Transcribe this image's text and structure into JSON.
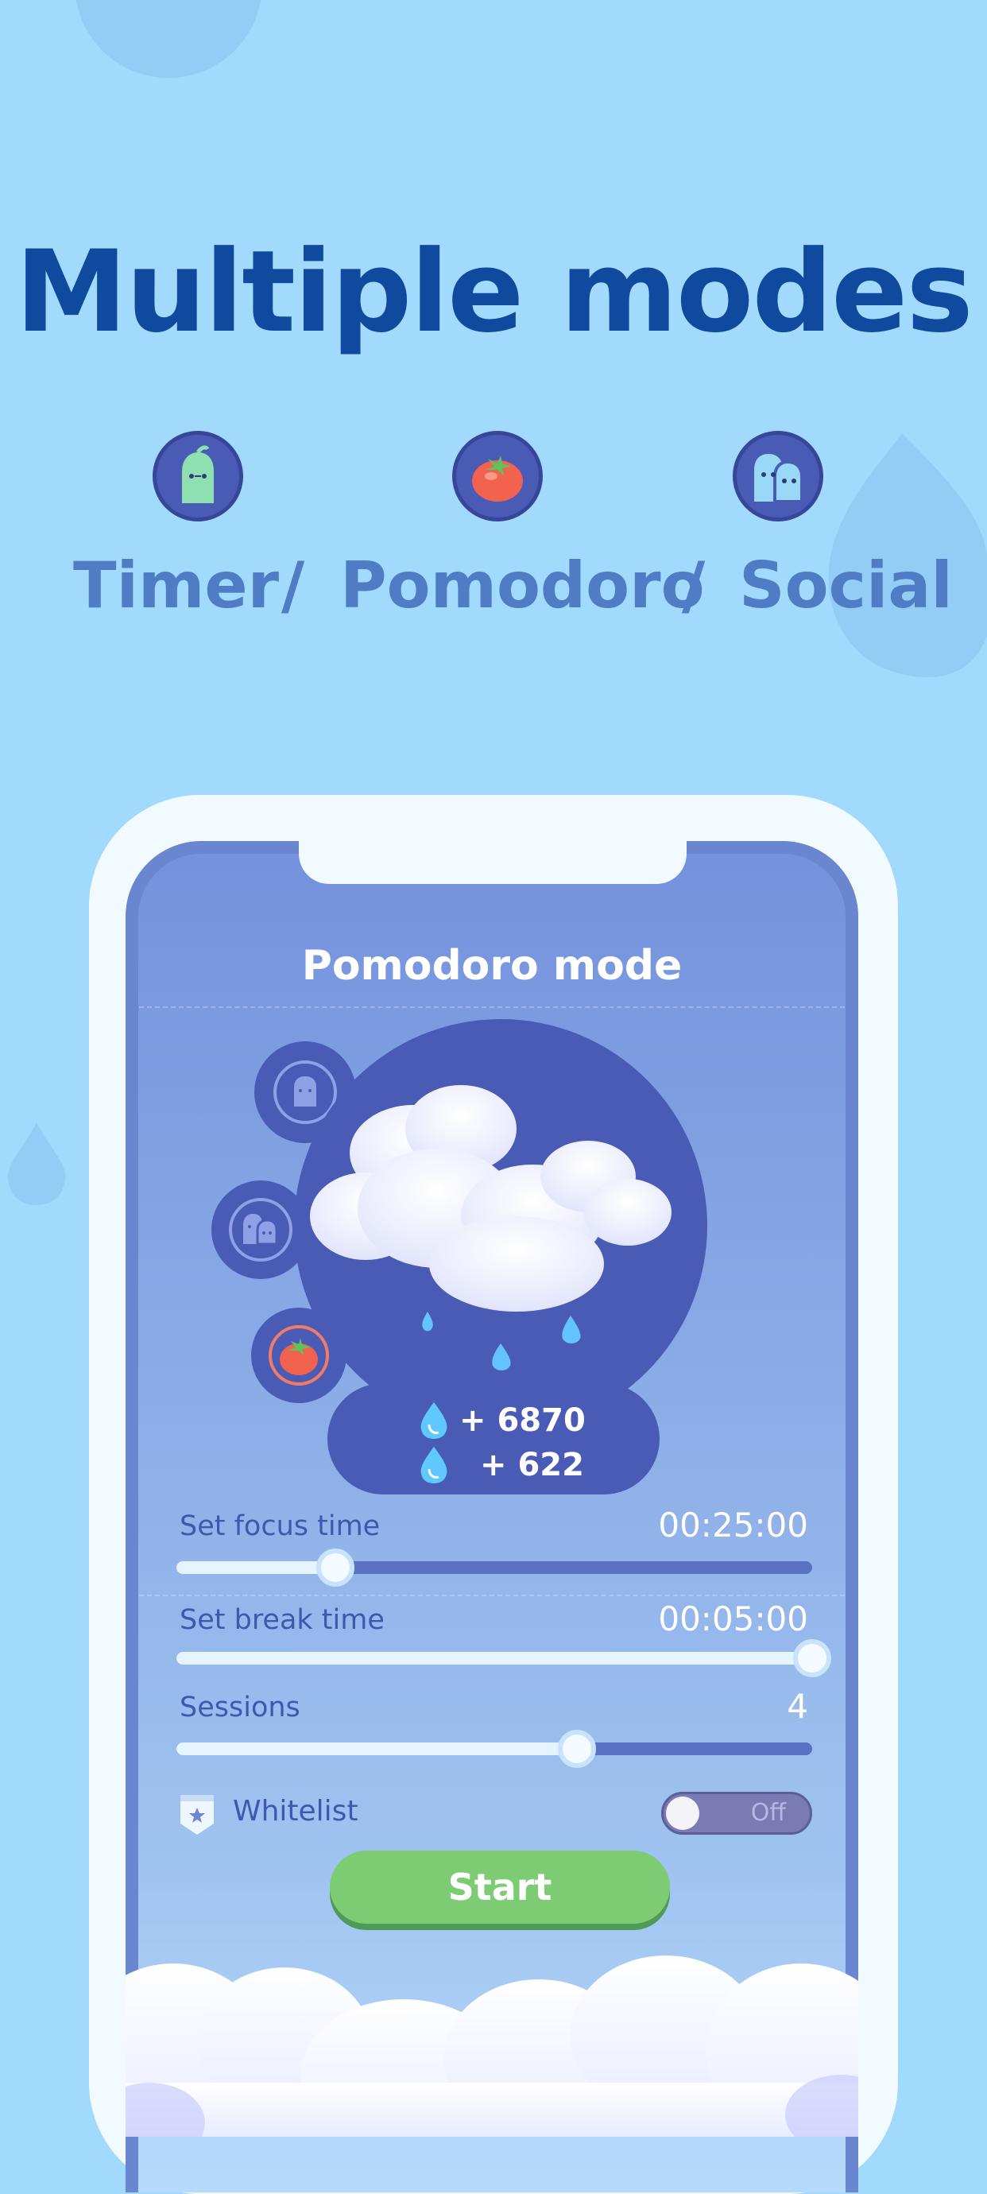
{
  "headline": "Multiple modes",
  "modes": [
    {
      "label": "Timer",
      "icon": "timer-ghost-icon"
    },
    {
      "label": "Pomodoro",
      "icon": "tomato-icon"
    },
    {
      "label": "Social",
      "icon": "social-ghosts-icon"
    }
  ],
  "separator": "/",
  "screen": {
    "title": "Pomodoro mode",
    "side_buttons": [
      "timer-mode-icon",
      "social-mode-icon",
      "pomodoro-mode-icon"
    ],
    "rewards": [
      "+ 6870",
      "+ 622"
    ],
    "settings": [
      {
        "label": "Set focus time",
        "value": "00:25:00",
        "level": 0.25
      },
      {
        "label": "Set break time",
        "value": "00:05:00",
        "level": 1.0
      },
      {
        "label": "Sessions",
        "value": "4",
        "level": 0.63
      }
    ],
    "whitelist_label": "Whitelist",
    "whitelist_toggle": "Off",
    "start_label": "Start"
  },
  "colors": {
    "background": "#a2dafd",
    "headline": "#0f4a9e",
    "accent_panel": "#4a5bb5",
    "start_button": "#7dcc73"
  }
}
